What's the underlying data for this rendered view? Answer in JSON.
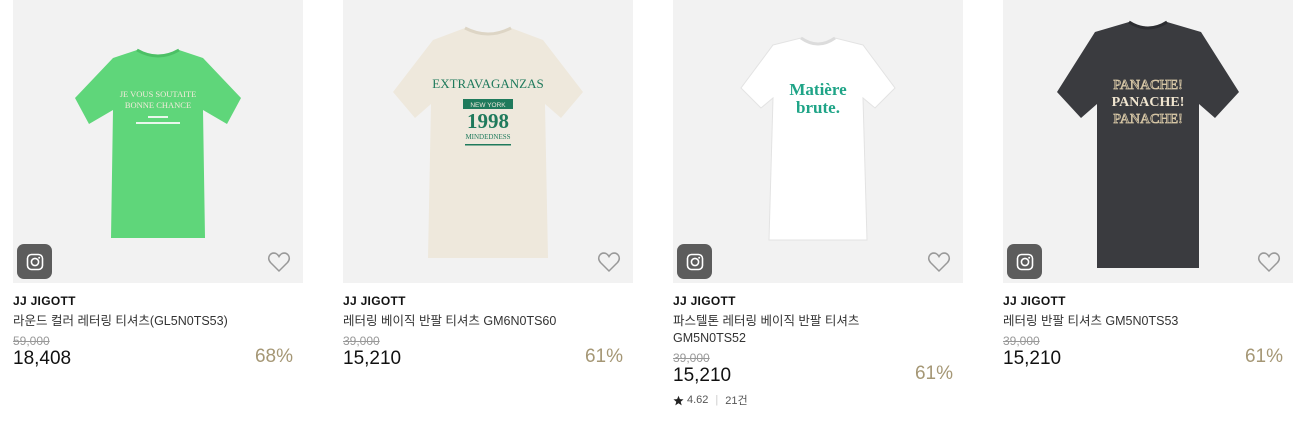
{
  "products": [
    {
      "brand": "JJ JIGOTT",
      "name": "라운드 컬러 레터링 티셔츠(GL5N0TS53)",
      "original_price": "59,000",
      "price": "18,408",
      "discount": "68%",
      "shirt_color": "#5fd67a",
      "print_lines": [
        "JE VOUS SOUTAITE",
        "BONNE CHANCE"
      ]
    },
    {
      "brand": "JJ JIGOTT",
      "name": "레터링 베이직 반팔 티셔츠 GM6N0TS60",
      "original_price": "39,000",
      "price": "15,210",
      "discount": "61%",
      "shirt_color": "#eee8dc",
      "print_lines": [
        "EXTRAVAGANZAS",
        "NEW YORK",
        "1998",
        "MINDEDNESS"
      ]
    },
    {
      "brand": "JJ JIGOTT",
      "name": "파스텔톤 레터링 베이직 반팔 티셔츠 GM5N0TS52",
      "original_price": "39,000",
      "price": "15,210",
      "discount": "61%",
      "shirt_color": "#ffffff",
      "print_lines": [
        "Matière",
        "brute."
      ],
      "rating": "4.62",
      "review_count": "21건"
    },
    {
      "brand": "JJ JIGOTT",
      "name": "레터링 반팔 티셔츠 GM5N0TS53",
      "original_price": "39,000",
      "price": "15,210",
      "discount": "61%",
      "shirt_color": "#3a3b3f",
      "print_lines": [
        "PANACHE!",
        "PANACHE!",
        "PANACHE!"
      ]
    }
  ],
  "icons": {
    "instagram": "instagram-icon",
    "wishlist": "heart-outline-icon",
    "star": "star-icon"
  }
}
